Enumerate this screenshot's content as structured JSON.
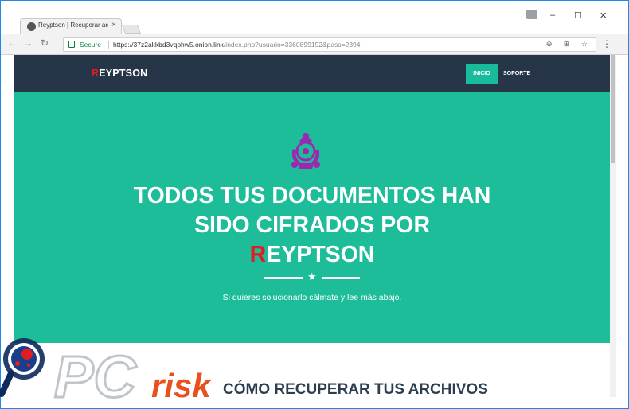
{
  "browser": {
    "tab_title": "Reyptson | Recuperar arc",
    "tab_close": "×",
    "address": {
      "secure_label": "Secure",
      "url_host": "https://37z2akkbd3vqphw5.onion.link",
      "url_path": "/index.php?usuario=3360899192&pass=2394"
    },
    "controls": {
      "minimize": "–",
      "maximize": "☐",
      "close": "✕",
      "back": "←",
      "forward": "→",
      "reload": "↻",
      "menu": "⋮"
    },
    "omnibox_icons": "⊕ ⊞ ☆"
  },
  "site": {
    "brand_first": "R",
    "brand_rest": "EYPTSON",
    "nav": {
      "inicio": "INICIO",
      "soporte": "SOPORTE"
    },
    "hero": {
      "headline_line1": "TODOS TUS DOCUMENTOS HAN",
      "headline_line2": "SIDO CIFRADOS POR",
      "headline_brand_first": "R",
      "headline_brand_rest": "EYPTSON",
      "star": "★",
      "subtitle": "Si quieres solucionarlo cálmate y lee más abajo."
    },
    "section_title": "CÓMO RECUPERAR TUS ARCHIVOS"
  },
  "watermark": {
    "text_pc": "PC",
    "text_risk": "risk"
  },
  "colors": {
    "nav_bg": "#263548",
    "hero_bg": "#1dbd99",
    "accent_green": "#18bc9c",
    "brand_red": "#e31b23",
    "hazard_purple": "#9c27b0"
  },
  "icons": [
    "biohazard-icon",
    "star-icon",
    "lock-icon",
    "back-icon",
    "forward-icon",
    "reload-icon",
    "bookmark-star-icon",
    "menu-icon"
  ]
}
